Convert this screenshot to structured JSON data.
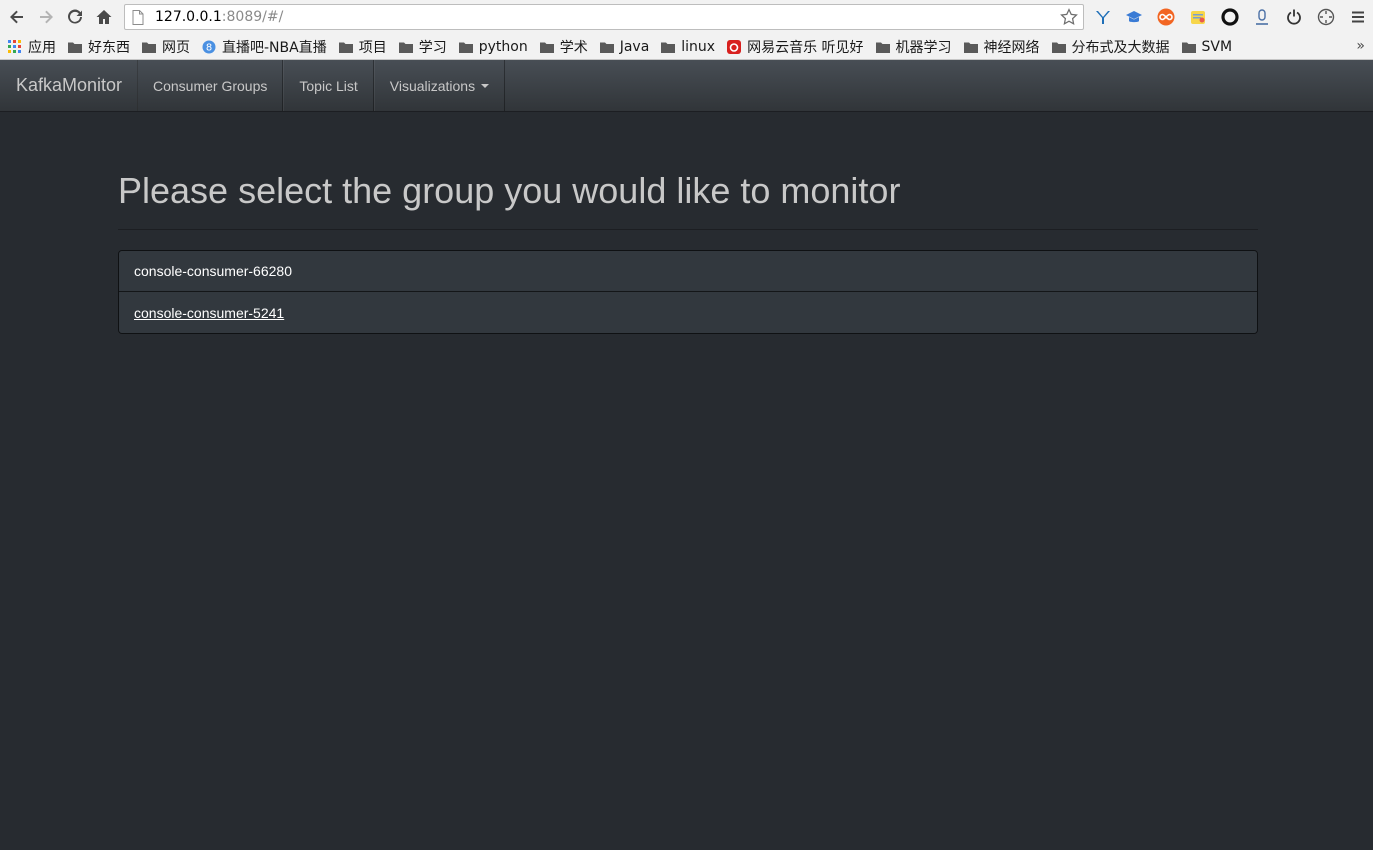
{
  "browser": {
    "url_host": "127.0.0.1",
    "url_rest": ":8089/#/",
    "bookmarks": [
      {
        "label": "应用",
        "icon": "apps-grid-icon",
        "color": "#4285f4"
      },
      {
        "label": "好东西",
        "icon": "folder-icon"
      },
      {
        "label": "网页",
        "icon": "folder-icon"
      },
      {
        "label": "直播吧-NBA直播",
        "icon": "site-favicon-icon",
        "color": "#4a90e2"
      },
      {
        "label": "项目",
        "icon": "folder-icon"
      },
      {
        "label": "学习",
        "icon": "folder-icon"
      },
      {
        "label": "python",
        "icon": "folder-icon"
      },
      {
        "label": "学术",
        "icon": "folder-icon"
      },
      {
        "label": "Java",
        "icon": "folder-icon"
      },
      {
        "label": "linux",
        "icon": "folder-icon"
      },
      {
        "label": "网易云音乐 听见好",
        "icon": "netease-music-icon",
        "color": "#d8201e"
      },
      {
        "label": "机器学习",
        "icon": "folder-icon"
      },
      {
        "label": "神经网络",
        "icon": "folder-icon"
      },
      {
        "label": "分布式及大数据",
        "icon": "folder-icon"
      },
      {
        "label": "SVM",
        "icon": "folder-icon"
      }
    ],
    "more_label": "»"
  },
  "navbar": {
    "brand": "KafkaMonitor",
    "items": [
      {
        "label": "Consumer Groups"
      },
      {
        "label": "Topic List"
      },
      {
        "label": "Visualizations",
        "dropdown": true
      }
    ]
  },
  "main": {
    "title": "Please select the group you would like to monitor",
    "groups": [
      {
        "name": "console-consumer-66280"
      },
      {
        "name": "console-consumer-5241",
        "hovered": true
      }
    ]
  },
  "colors": {
    "background": "#272b30",
    "navbar": "#3a3f44",
    "list_item": "#32383e",
    "text": "#c8c8c8"
  }
}
